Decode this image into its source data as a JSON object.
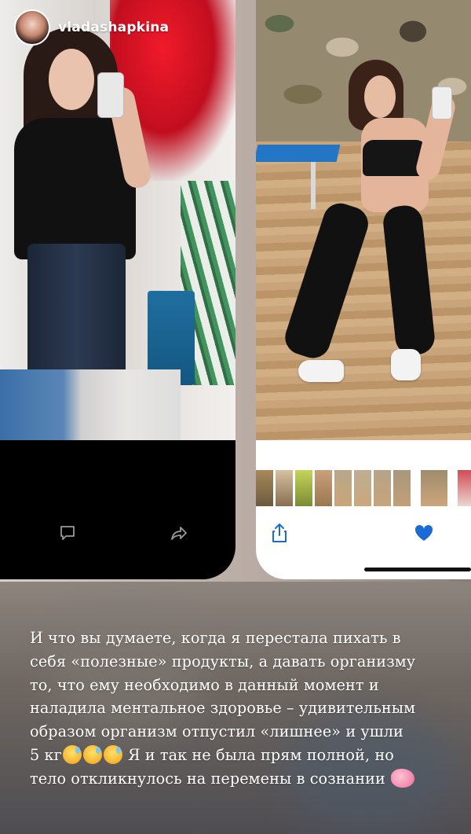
{
  "header": {
    "username": "vladashapkina"
  },
  "left_post": {
    "comment_icon": "comment-icon",
    "share_icon": "share-icon"
  },
  "right_photos": {
    "share_icon": "share-icon",
    "favorite_icon": "heart-icon",
    "favorite_color": "#1a6bd6"
  },
  "caption": {
    "line1": "И что вы думаете, когда я перестала пихать в",
    "line2": "себя «полезные» продукты, а давать организму",
    "line3": "то, что ему необходимо в данный момент и",
    "line4": "наладила ментальное здоровье – удивительным",
    "line5": "образом организм отпустил «лишнее» и ушли",
    "line6_start": "5 кг",
    "line6_end": "Я и так не была прям полной, но",
    "line7": "тело откликнулось на перемены в сознании"
  },
  "emoji_icons": [
    "sweat-smile-icon",
    "brain-icon"
  ]
}
